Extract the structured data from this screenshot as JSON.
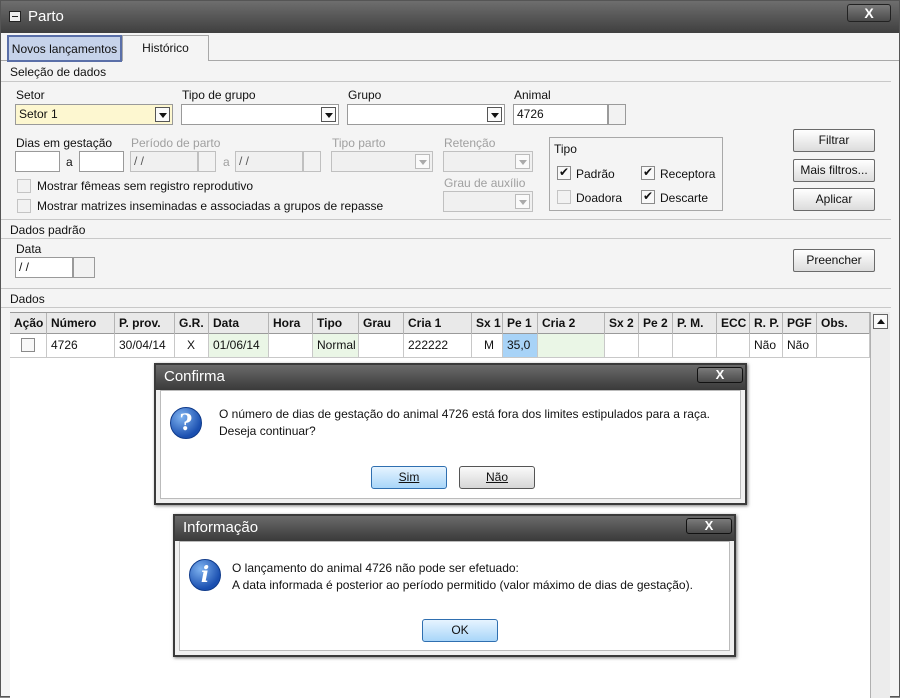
{
  "window": {
    "title": "Parto",
    "close_label": "X"
  },
  "tabs": [
    {
      "label": "Novos lançamentos",
      "active": true
    },
    {
      "label": "Histórico",
      "active": false
    }
  ],
  "selecao": {
    "section_label": "Seleção de dados",
    "setor": {
      "label": "Setor",
      "value": "Setor 1"
    },
    "tipo_grupo": {
      "label": "Tipo de grupo",
      "value": ""
    },
    "grupo": {
      "label": "Grupo",
      "value": ""
    },
    "animal": {
      "label": "Animal",
      "value": "4726"
    },
    "dias_gestacao": {
      "label": "Dias em gestação",
      "from": "",
      "sep": "a",
      "to": ""
    },
    "periodo_parto": {
      "label": "Período de parto",
      "from": " / / ",
      "sep": "a",
      "to": " / / "
    },
    "tipo_parto": {
      "label": "Tipo parto",
      "value": ""
    },
    "retencao": {
      "label": "Retenção",
      "value": ""
    },
    "grau_auxilio": {
      "label": "Grau de auxílio",
      "value": ""
    },
    "mostrar_femeas": {
      "label": "Mostrar fêmeas sem registro reprodutivo",
      "checked": false
    },
    "mostrar_matrizes": {
      "label": "Mostrar matrizes inseminadas e associadas a grupos de repasse",
      "checked": false
    },
    "tipo": {
      "label": "Tipo",
      "padrao": {
        "label": "Padrão",
        "checked": true
      },
      "receptora": {
        "label": "Receptora",
        "checked": true
      },
      "doadora": {
        "label": "Doadora",
        "checked": false
      },
      "descarte": {
        "label": "Descarte",
        "checked": true
      }
    },
    "buttons": {
      "filtrar": "Filtrar",
      "mais_filtros": "Mais filtros...",
      "aplicar": "Aplicar"
    }
  },
  "dados_padrao": {
    "section_label": "Dados padrão",
    "data": {
      "label": "Data",
      "value": " / / "
    },
    "preencher": "Preencher"
  },
  "dados": {
    "section_label": "Dados",
    "columns": [
      "Ação",
      "Número",
      "P. prov.",
      "G.R.",
      "Data",
      "Hora",
      "Tipo",
      "Grau",
      "Cria 1",
      "Sx 1",
      "Pe 1",
      "Cria 2",
      "Sx 2",
      "Pe 2",
      "P. M.",
      "ECC",
      "R. P.",
      "PGF",
      "Obs."
    ],
    "rows": [
      {
        "acao_checked": false,
        "numero": "4726",
        "p_prov": "30/04/14",
        "gr": "X",
        "data": "01/06/14",
        "hora": "",
        "tipo": "Normal",
        "grau": "",
        "cria1": "222222",
        "sx1": "M",
        "pe1": "35,0",
        "cria2": "",
        "sx2": "",
        "pe2": "",
        "pm": "",
        "ecc": "",
        "rp": "Não",
        "pgf": "Não",
        "obs": ""
      }
    ]
  },
  "confirma": {
    "title": "Confirma",
    "close_label": "X",
    "icon": "question-icon",
    "line1": "O número de dias de gestação do animal 4726 está fora dos limites estipulados para a raça.",
    "line2": "Deseja continuar?",
    "sim_label": "Sim",
    "nao_label": "Não"
  },
  "informacao": {
    "title": "Informação",
    "close_label": "X",
    "icon": "info-icon",
    "line1": "O lançamento do animal 4726 não pode ser efetuado:",
    "line2": "A data informada é posterior ao período permitido (valor máximo de dias de gestação).",
    "ok_label": "OK"
  }
}
